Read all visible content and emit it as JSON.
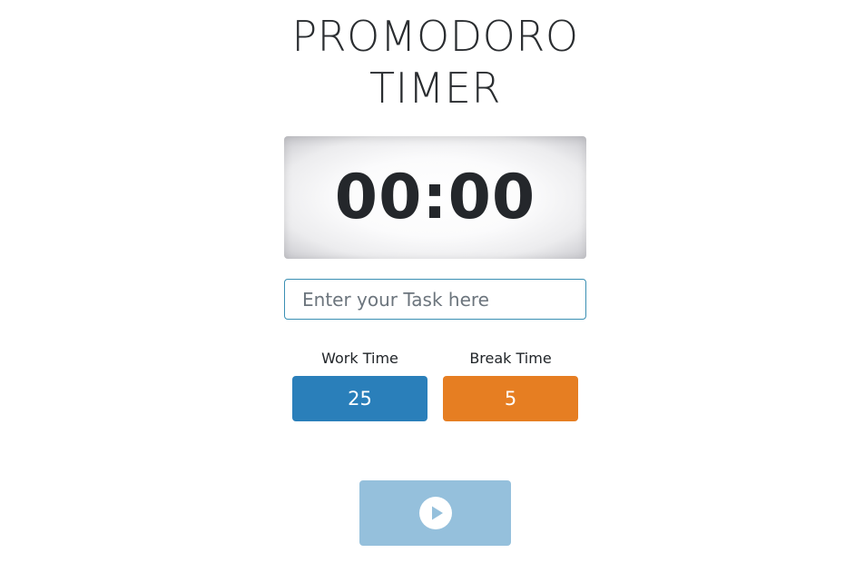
{
  "app": {
    "title_line1": "PROMODORO",
    "title_line2": "TIMER"
  },
  "timer": {
    "display": "00:00"
  },
  "task": {
    "placeholder": "Enter your Task here",
    "value": ""
  },
  "settings": {
    "work_label": "Work Time",
    "work_value": "25",
    "break_label": "Break Time",
    "break_value": "5"
  },
  "controls": {
    "start_icon": "play-icon"
  },
  "colors": {
    "work": "#2a7fba",
    "break": "#e67e22",
    "start_button": "#95c0dc"
  }
}
